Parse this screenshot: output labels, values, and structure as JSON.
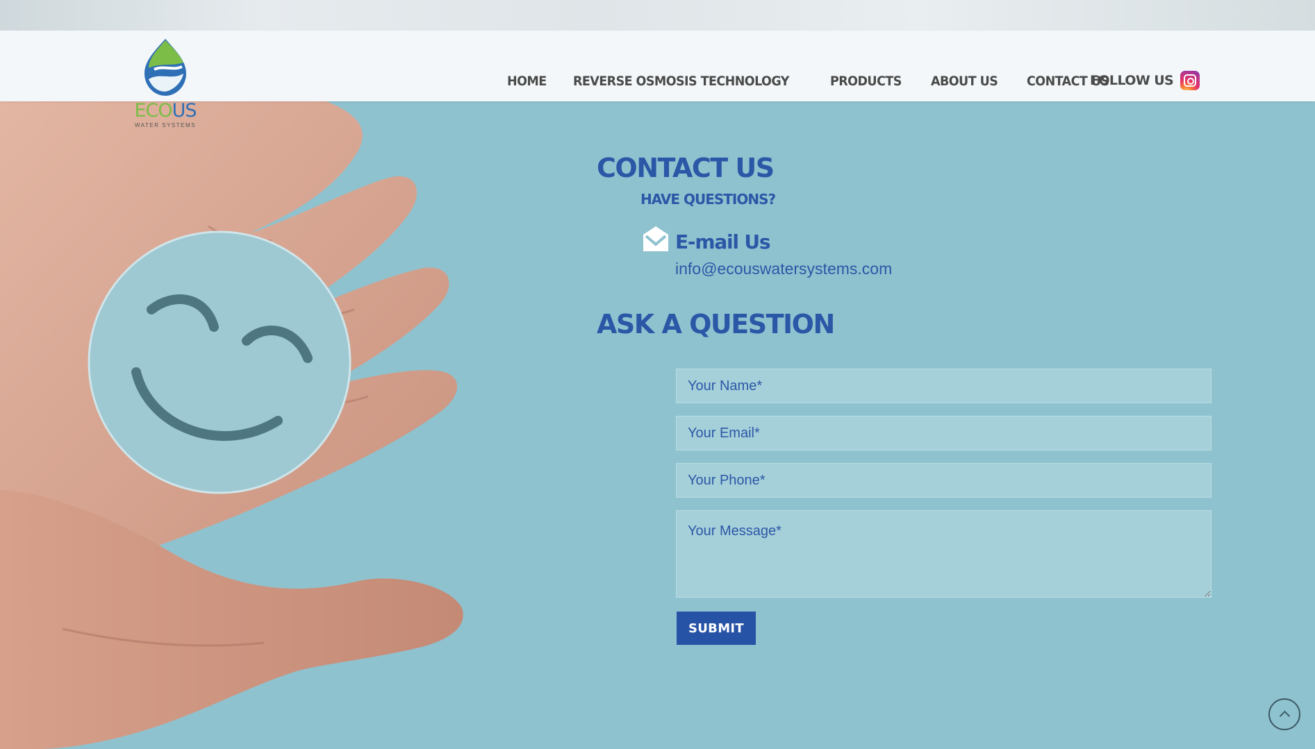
{
  "brand": {
    "logo_word_eco": "ECO",
    "logo_word_us": "US",
    "logo_sub": "WATER SYSTEMS",
    "colors": {
      "green": "#7bbd47",
      "blue": "#2e6fb6"
    }
  },
  "nav": {
    "items": [
      {
        "label": "HOME"
      },
      {
        "label": "REVERSE OSMOSIS TECHNOLOGY"
      },
      {
        "label": "PRODUCTS"
      },
      {
        "label": "ABOUT US"
      },
      {
        "label": "CONTACT US"
      }
    ],
    "follow_label": "FOLLOW US",
    "social_icon": "instagram-icon"
  },
  "contact": {
    "title": "CONTACT US",
    "subtitle": "HAVE QUESTIONS?",
    "email_heading": "E-mail Us",
    "email_address": "info@ecouswatersystems.com",
    "email_icon": "envelope-icon"
  },
  "form": {
    "title": "ASK A QUESTION",
    "name_placeholder": "Your Name*",
    "email_placeholder": "Your Email*",
    "phone_placeholder": "Your Phone*",
    "message_placeholder": "Your Message*",
    "submit_label": "SUBMIT"
  },
  "theme": {
    "accent": "#2b57a7",
    "button": "#2653a6",
    "background": "#8fc2cf"
  }
}
